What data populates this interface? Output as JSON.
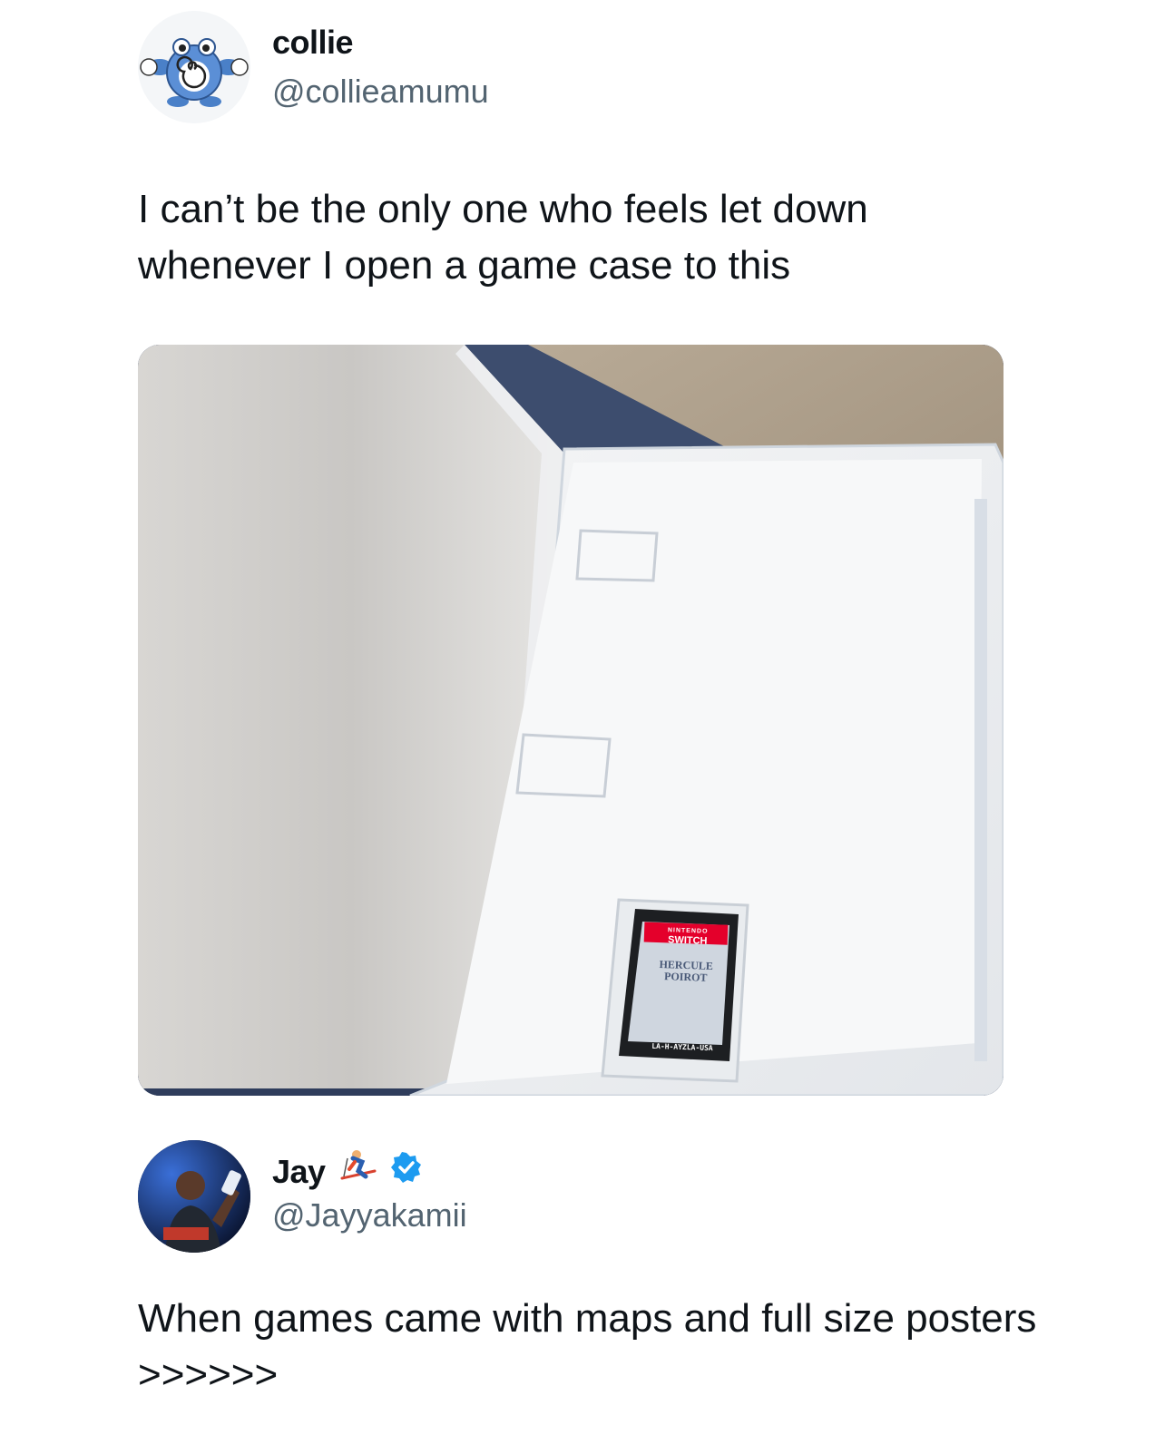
{
  "tweet1": {
    "display_name": "collie",
    "handle": "@collieamumu",
    "text": "I can’t be the only one who feels let down whenever I open a game case to this",
    "avatar_icon": "poliwag-avatar",
    "media_icon": "open-game-case-photo",
    "cartridge": {
      "brand": "NINTENDO",
      "platform": "SWITCH",
      "title_line1": "HERCULE",
      "title_line2": "POIROT",
      "code": "LA-H-AYZLA-USA"
    }
  },
  "tweet2": {
    "display_name": "Jay",
    "handle": "@Jayyakamii",
    "text": "When games came with maps and full size posters >>>>>>",
    "avatar_icon": "profile-photo-avatar",
    "emoji_icon": "skier-emoji",
    "verified_icon": "verified-badge-icon",
    "verified_color": "#1d9bf0"
  }
}
